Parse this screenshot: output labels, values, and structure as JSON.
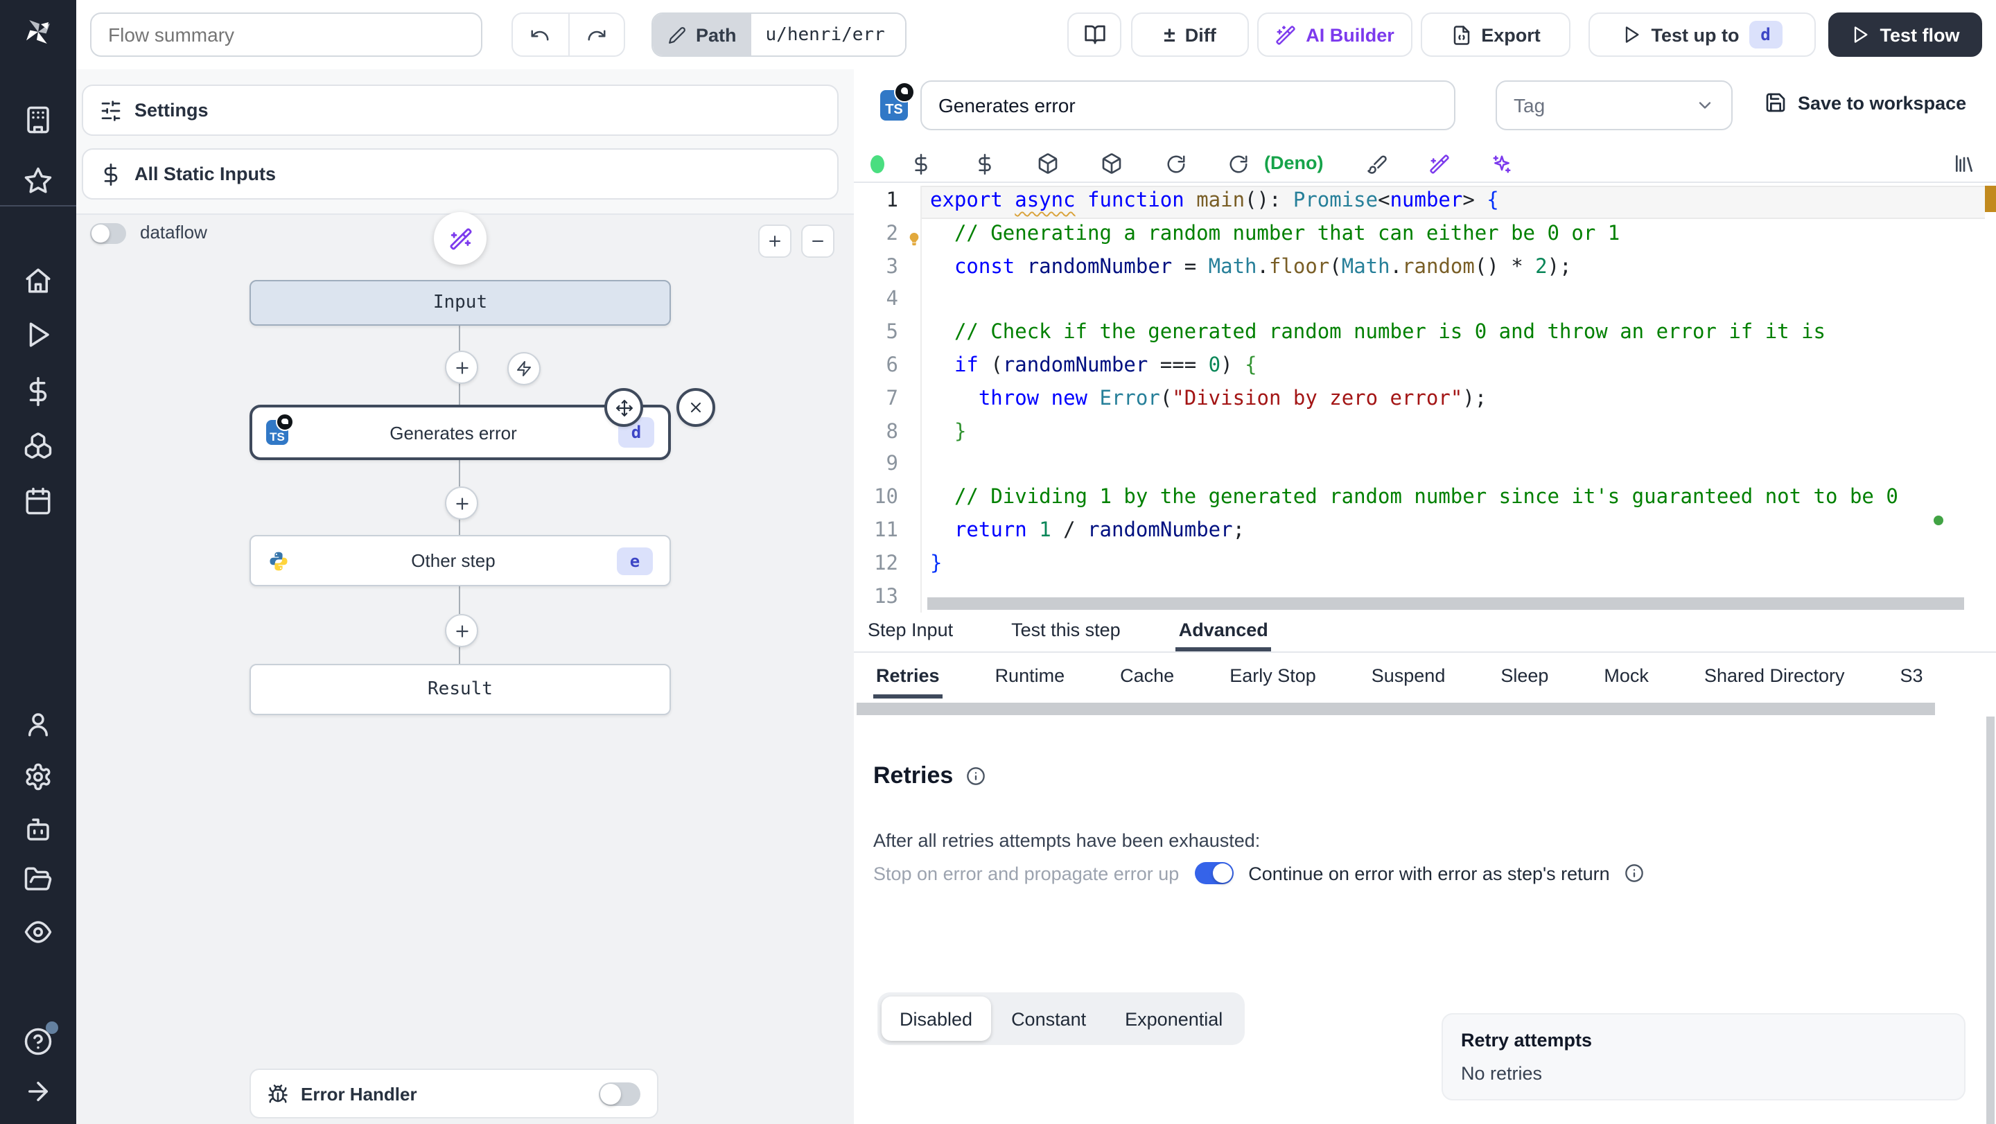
{
  "topbar": {
    "flow_summary_placeholder": "Flow summary",
    "path_label": "Path",
    "path_value": "u/henri/err",
    "diff_label": "Diff",
    "ai_builder_label": "AI Builder",
    "export_label": "Export",
    "test_up_to_label": "Test up to",
    "test_up_to_badge": "d",
    "test_flow_label": "Test flow"
  },
  "sidebar": {
    "icons": [
      "windmill-logo",
      "workspace-building-icon",
      "favorites-star-icon",
      "home-icon",
      "runs-play-icon",
      "variables-dollar-icon",
      "resources-boxes-icon",
      "schedules-calendar-icon",
      "user-icon",
      "settings-gear-icon",
      "workers-robot-icon",
      "folders-icon",
      "audit-eye-icon",
      "help-icon",
      "expand-arrow-icon"
    ]
  },
  "flow_panel": {
    "settings_label": "Settings",
    "static_inputs_label": "All Static Inputs",
    "dataflow_label": "dataflow",
    "error_handler_label": "Error Handler",
    "nodes": {
      "input_label": "Input",
      "step1_label": "Generates error",
      "step1_badge": "d",
      "step2_label": "Other step",
      "step2_badge": "e",
      "result_label": "Result"
    }
  },
  "editor": {
    "title_value": "Generates error",
    "tag_placeholder": "Tag",
    "save_label": "Save to workspace",
    "runtime_label": "(Deno)",
    "tabs": [
      "Step Input",
      "Test this step",
      "Advanced"
    ],
    "active_tab": "Advanced",
    "subtabs": [
      "Retries",
      "Runtime",
      "Cache",
      "Early Stop",
      "Suspend",
      "Sleep",
      "Mock",
      "Shared Directory",
      "S3"
    ],
    "active_subtab": "Retries",
    "code": {
      "language": "typescript (deno)",
      "bulb_line": 2,
      "lines": [
        {
          "t": [
            [
              "kw",
              "export"
            ],
            [
              "pl",
              " "
            ],
            [
              "kwu",
              "async"
            ],
            [
              "pl",
              " "
            ],
            [
              "kw",
              "function"
            ],
            [
              "pl",
              " "
            ],
            [
              "fn",
              "main"
            ],
            [
              "pl",
              "(): "
            ],
            [
              "ty",
              "Promise"
            ],
            [
              "pl",
              "<"
            ],
            [
              "kw",
              "number"
            ],
            [
              "pl",
              "> "
            ],
            [
              "b1",
              "{"
            ]
          ]
        },
        {
          "t": [
            [
              "pl",
              "  "
            ],
            [
              "cm",
              "// Generating a random number that can either be 0 or 1"
            ]
          ]
        },
        {
          "t": [
            [
              "pl",
              "  "
            ],
            [
              "kw",
              "const"
            ],
            [
              "pl",
              " "
            ],
            [
              "vr",
              "randomNumber"
            ],
            [
              "pl",
              " = "
            ],
            [
              "ty",
              "Math"
            ],
            [
              "pl",
              "."
            ],
            [
              "fn",
              "floor"
            ],
            [
              "pl",
              "("
            ],
            [
              "ty",
              "Math"
            ],
            [
              "pl",
              "."
            ],
            [
              "fn",
              "random"
            ],
            [
              "pl",
              "() * "
            ],
            [
              "nm",
              "2"
            ],
            [
              "pl",
              ");"
            ]
          ]
        },
        {
          "t": []
        },
        {
          "t": [
            [
              "pl",
              "  "
            ],
            [
              "cm",
              "// Check if the generated random number is 0 and throw an error if it is"
            ]
          ]
        },
        {
          "t": [
            [
              "pl",
              "  "
            ],
            [
              "kw",
              "if"
            ],
            [
              "pl",
              " ("
            ],
            [
              "vr",
              "randomNumber"
            ],
            [
              "pl",
              " === "
            ],
            [
              "nm",
              "0"
            ],
            [
              "pl",
              ") "
            ],
            [
              "b2",
              "{"
            ]
          ]
        },
        {
          "t": [
            [
              "pl",
              "    "
            ],
            [
              "kw",
              "throw"
            ],
            [
              "pl",
              " "
            ],
            [
              "kw",
              "new"
            ],
            [
              "pl",
              " "
            ],
            [
              "ty",
              "Error"
            ],
            [
              "pl",
              "("
            ],
            [
              "st",
              "\"Division by zero error\""
            ],
            [
              "pl",
              ");"
            ]
          ]
        },
        {
          "t": [
            [
              "pl",
              "  "
            ],
            [
              "b2",
              "}"
            ]
          ]
        },
        {
          "t": []
        },
        {
          "t": [
            [
              "pl",
              "  "
            ],
            [
              "cm",
              "// Dividing 1 by the generated random number since it's guaranteed not to be 0"
            ]
          ]
        },
        {
          "t": [
            [
              "pl",
              "  "
            ],
            [
              "kw",
              "return"
            ],
            [
              "pl",
              " "
            ],
            [
              "nm",
              "1"
            ],
            [
              "pl",
              " / "
            ],
            [
              "vr",
              "randomNumber"
            ],
            [
              "pl",
              ";"
            ]
          ]
        },
        {
          "t": [
            [
              "b1",
              "}"
            ]
          ]
        },
        {
          "t": []
        }
      ]
    }
  },
  "retries": {
    "heading": "Retries",
    "exhausted_label": "After all retries attempts have been exhausted:",
    "stop_option": "Stop on error and propagate error up",
    "continue_option": "Continue on error with error as step's return",
    "continue_enabled": true,
    "modes": [
      "Disabled",
      "Constant",
      "Exponential"
    ],
    "active_mode": "Disabled",
    "retry_attempts_label": "Retry attempts",
    "retry_attempts_value": "No retries"
  },
  "colors": {
    "sidebar_bg": "#1e2430",
    "accent_blue_toggle": "#3563e9",
    "ai_purple": "#7c3aed",
    "deno_green": "#16a34a",
    "badge_bg": "#dbe1fb",
    "badge_text": "#3d46c6",
    "selected_node_border": "#3f4a5c",
    "input_node_bg": "#dce4ef",
    "dark_button_bg": "#2b313e",
    "ruler_warning": "#c28a1e"
  }
}
